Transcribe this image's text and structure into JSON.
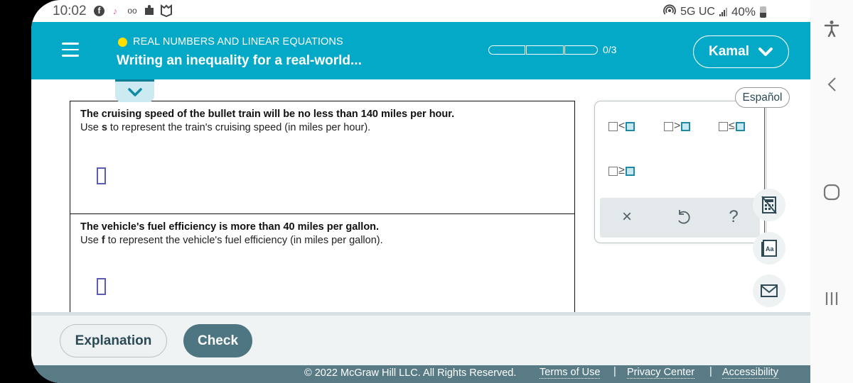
{
  "status_bar": {
    "time": "10:02",
    "left_icons": [
      "facebook-icon",
      "tiktok-icon",
      "voicemail-icon",
      "puzzle-icon",
      "shield-m-icon"
    ],
    "network": "5G UC",
    "battery": "40%"
  },
  "header": {
    "menu_icon": "hamburger-menu-icon",
    "topic": "REAL NUMBERS AND LINEAR EQUATIONS",
    "topic_dot_color": "#ffde00",
    "title": "Writing an inequality for a real-world...",
    "progress": {
      "completed": 0,
      "total": 3,
      "label": "0/3"
    },
    "user_name": "Kamal"
  },
  "language_button": "Español",
  "problems": [
    {
      "statement": "The cruising speed of the bullet train will be no less than 140 miles per hour.",
      "hint_prefix": "Use ",
      "variable": "s",
      "hint_suffix": " to represent the train's cruising speed (in miles per hour).",
      "answer": ""
    },
    {
      "statement": "The vehicle's fuel efficiency is more than 40 miles per gallon.",
      "hint_prefix": "Use ",
      "variable": "f",
      "hint_suffix": " to represent the vehicle's fuel efficiency (in miles per gallon).",
      "answer": ""
    }
  ],
  "keypad": {
    "keys": [
      {
        "name": "less-than",
        "op": "<"
      },
      {
        "name": "greater-than",
        "op": ">"
      },
      {
        "name": "less-or-equal",
        "op": "≤"
      },
      {
        "name": "greater-or-equal",
        "op": "≥"
      }
    ],
    "actions": {
      "clear": "×",
      "undo": "↺",
      "help": "?"
    }
  },
  "tools": [
    "calculator-icon",
    "dictionary-icon",
    "mail-icon"
  ],
  "actions": {
    "explanation": "Explanation",
    "check": "Check"
  },
  "footer": {
    "copyright": "© 2022 McGraw Hill LLC. All Rights Reserved.",
    "links": [
      "Terms of Use",
      "Privacy Center",
      "Accessibility"
    ],
    "separator": "|"
  },
  "colors": {
    "header": "#04a9c7",
    "check_button": "#4e7682",
    "footer": "#587b86",
    "answer_box": "#5b5bb8"
  }
}
